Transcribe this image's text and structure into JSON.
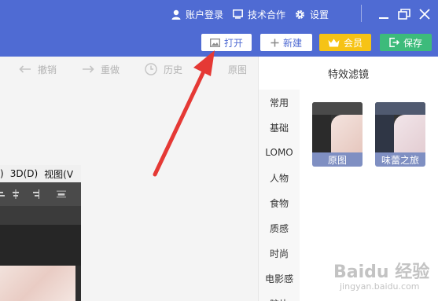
{
  "header": {
    "links": [
      {
        "label": "账户登录",
        "icon": "user-icon"
      },
      {
        "label": "技术合作",
        "icon": "monitor-icon"
      },
      {
        "label": "设置",
        "icon": "gear-icon"
      }
    ],
    "window_controls": [
      "minimize-icon",
      "restore-icon",
      "close-icon"
    ],
    "buttons": {
      "open": "打开",
      "new": "新建",
      "vip": "会员",
      "save": "保存"
    },
    "colors": {
      "bar": "#4f6bd3",
      "vip": "#f6c315",
      "save": "#3dbb7b"
    }
  },
  "edit_toolbar": {
    "undo": "撤销",
    "redo": "重做",
    "history": "历史",
    "original": "原图"
  },
  "photoshop": {
    "menu_items": [
      ")",
      "3D(D)",
      "视图(V"
    ]
  },
  "panel": {
    "title": "特效滤镜",
    "categories": [
      "常用",
      "基础",
      "LOMO",
      "人物",
      "食物",
      "质感",
      "时尚",
      "电影感",
      "胶片"
    ],
    "active_category": "常用",
    "filters": [
      {
        "label": "原图"
      },
      {
        "label": "味蕾之旅"
      }
    ]
  },
  "watermark": {
    "brand": "Baidu 经验",
    "url": "jingyan.baidu.com"
  }
}
